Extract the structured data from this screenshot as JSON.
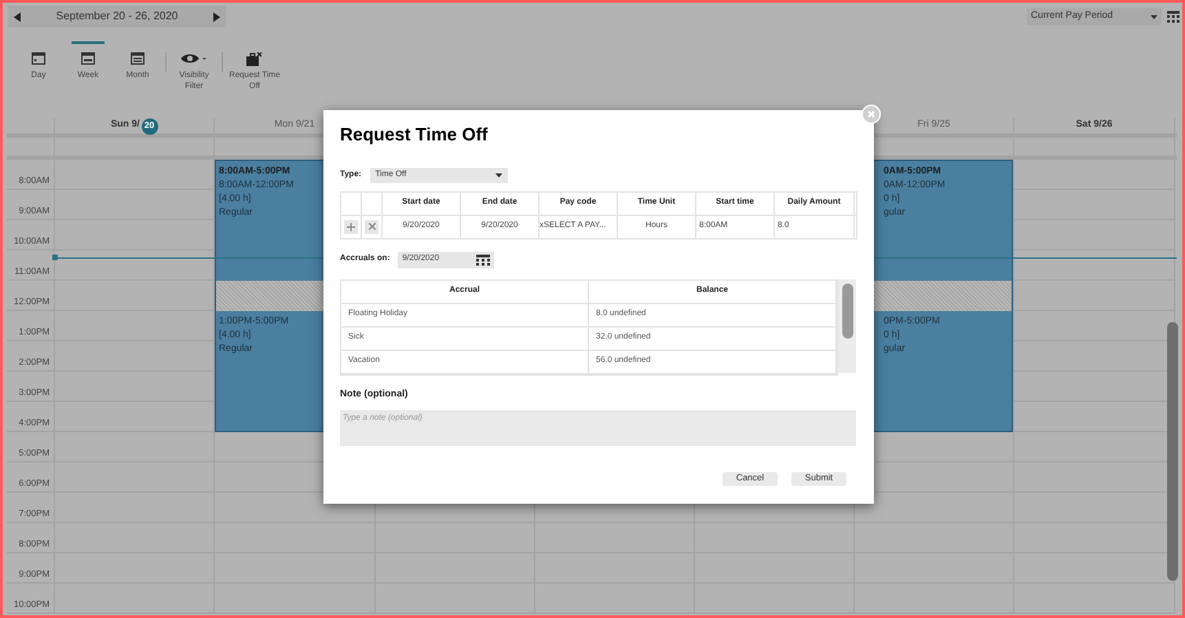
{
  "toolbar": {
    "date_range": "September 20 - 26, 2020",
    "pay_period": "Current Pay Period",
    "items": [
      {
        "kind": "day",
        "label": "Day",
        "selected": false
      },
      {
        "kind": "week",
        "label": "Week",
        "selected": true
      },
      {
        "kind": "month",
        "label": "Month",
        "selected": false
      },
      {
        "kind": "filter",
        "label": "Visibility Filter",
        "selected": false
      },
      {
        "kind": "timeoff",
        "label": "Request Time Off",
        "selected": false
      }
    ]
  },
  "calendar": {
    "days": [
      {
        "label": "Sun 9/",
        "badge": "20",
        "bold": true
      },
      {
        "label": "Mon 9/21",
        "bold": false,
        "shift": {
          "kind": "day_shift",
          "segments": [
            {
              "title": "8:00AM-5:00PM",
              "lines": [
                "8:00AM-12:00PM",
                "[4.00 h]",
                "Regular"
              ]
            },
            {
              "lines": [
                "1:00PM-5:00PM",
                "[4.00 h]",
                "Regular"
              ]
            }
          ]
        }
      },
      {
        "kind": "covered"
      },
      {
        "kind": "covered"
      },
      {
        "kind": "covered"
      },
      {
        "label": "Fri 9/25",
        "bold": false,
        "shift": {
          "kind": "day_shift",
          "segments": [
            {
              "title": "0AM-5:00PM",
              "lines": [
                "0AM-12:00PM",
                "0 h]",
                "gular"
              ]
            },
            {
              "lines": [
                "0PM-5:00PM",
                "0 h]",
                "gular"
              ]
            }
          ]
        }
      },
      {
        "label": "Sat 9/26",
        "bold": true
      }
    ],
    "hours": [
      "8:00AM",
      "9:00AM",
      "10:00AM",
      "11:00AM",
      "12:00PM",
      "1:00PM",
      "2:00PM",
      "3:00PM",
      "4:00PM",
      "5:00PM",
      "6:00PM",
      "7:00PM",
      "8:00PM",
      "9:00PM",
      "10:00PM"
    ]
  },
  "dialog": {
    "title": "Request Time Off",
    "type_label": "Type:",
    "type_value": "Time Off",
    "request_table": {
      "columns": [
        "Start date",
        "End date",
        "Pay code",
        "Time Unit",
        "Start time",
        "Daily Amount"
      ],
      "rows": [
        [
          "9/20/2020",
          "9/20/2020",
          "xSELECT A PAY...",
          "Hours",
          "8:00AM",
          "8.0"
        ]
      ]
    },
    "accruals_label": "Accruals on:",
    "accruals_date": "9/20/2020",
    "accrual_table": {
      "columns": [
        "Accrual",
        "Balance"
      ],
      "rows": [
        [
          "Floating Holiday",
          "8.0 undefined"
        ],
        [
          "Sick",
          "32.0 undefined"
        ],
        [
          "Vacation",
          "56.0 undefined"
        ]
      ]
    },
    "note_label": "Note (optional)",
    "note_placeholder": "Type a note (optional)",
    "buttons": [
      "Cancel",
      "Submit"
    ]
  }
}
